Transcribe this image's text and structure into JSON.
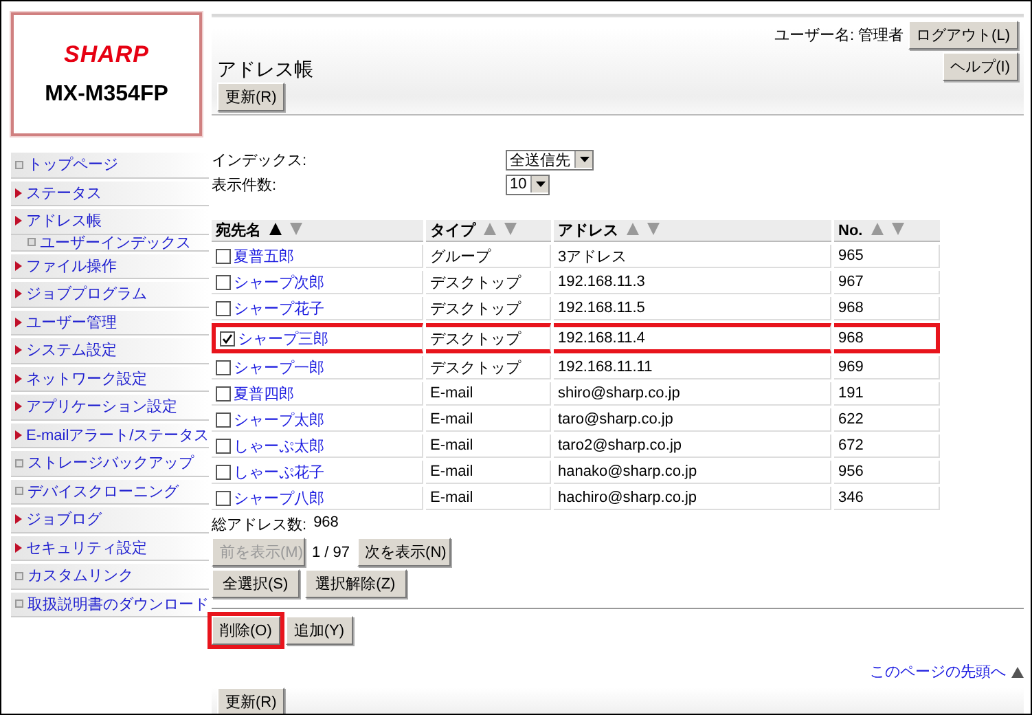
{
  "logo": {
    "brand": "SHARP",
    "model": "MX-M354FP"
  },
  "sidebar": {
    "items": [
      {
        "label": "トップページ",
        "kind": "square"
      },
      {
        "label": "ステータス",
        "kind": "arrow"
      },
      {
        "label": "アドレス帳",
        "kind": "arrow",
        "children": [
          {
            "label": "ユーザーインデックス",
            "kind": "square"
          }
        ]
      },
      {
        "label": "ファイル操作",
        "kind": "arrow"
      },
      {
        "label": "ジョブプログラム",
        "kind": "arrow"
      },
      {
        "label": "ユーザー管理",
        "kind": "arrow"
      },
      {
        "label": "システム設定",
        "kind": "arrow"
      },
      {
        "label": "ネットワーク設定",
        "kind": "arrow"
      },
      {
        "label": "アプリケーション設定",
        "kind": "arrow"
      },
      {
        "label": "E-mailアラート/ステータス",
        "kind": "arrow"
      },
      {
        "label": "ストレージバックアップ",
        "kind": "square"
      },
      {
        "label": "デバイスクローニング",
        "kind": "square"
      },
      {
        "label": "ジョブログ",
        "kind": "arrow"
      },
      {
        "label": "セキュリティ設定",
        "kind": "arrow"
      },
      {
        "label": "カスタムリンク",
        "kind": "square"
      },
      {
        "label": "取扱説明書のダウンロード",
        "kind": "square"
      }
    ]
  },
  "header": {
    "user_label": "ユーザー名:",
    "user_name": "管理者",
    "logout_button": "ログアウト(L)",
    "help_button": "ヘルプ(I)",
    "title": "アドレス帳",
    "refresh_button": "更新(R)"
  },
  "filters": [
    {
      "label": "インデックス:",
      "value": "全送信先"
    },
    {
      "label": "表示件数:",
      "value": "10"
    }
  ],
  "table": {
    "columns": [
      {
        "label": "宛先名",
        "sorted": true
      },
      {
        "label": "タイプ",
        "sorted": false
      },
      {
        "label": "アドレス",
        "sorted": false
      },
      {
        "label": "No.",
        "sorted": false
      }
    ],
    "rows": [
      {
        "checked": false,
        "highlighted": false,
        "name": "夏普五郎",
        "type": "グループ",
        "address": "3アドレス",
        "no": "965"
      },
      {
        "checked": false,
        "highlighted": false,
        "name": "シャープ次郎",
        "type": "デスクトップ",
        "address": "192.168.11.3",
        "no": "967"
      },
      {
        "checked": false,
        "highlighted": false,
        "name": "シャープ花子",
        "type": "デスクトップ",
        "address": "192.168.11.5",
        "no": "968"
      },
      {
        "checked": true,
        "highlighted": true,
        "name": "シャープ三郎",
        "type": "デスクトップ",
        "address": "192.168.11.4",
        "no": "968"
      },
      {
        "checked": false,
        "highlighted": false,
        "name": "シャープ一郎",
        "type": "デスクトップ",
        "address": "192.168.11.11",
        "no": "969"
      },
      {
        "checked": false,
        "highlighted": false,
        "name": "夏普四郎",
        "type": "E-mail",
        "address": "shiro@sharp.co.jp",
        "no": "191"
      },
      {
        "checked": false,
        "highlighted": false,
        "name": "シャープ太郎",
        "type": "E-mail",
        "address": "taro@sharp.co.jp",
        "no": "622"
      },
      {
        "checked": false,
        "highlighted": false,
        "name": "しゃーぷ太郎",
        "type": "E-mail",
        "address": "taro2@sharp.co.jp",
        "no": "672"
      },
      {
        "checked": false,
        "highlighted": false,
        "name": "しゃーぷ花子",
        "type": "E-mail",
        "address": "hanako@sharp.co.jp",
        "no": "956"
      },
      {
        "checked": false,
        "highlighted": false,
        "name": "シャープ八郎",
        "type": "E-mail",
        "address": "hachiro@sharp.co.jp",
        "no": "346"
      }
    ]
  },
  "total": {
    "label": "総アドレス数:",
    "value": "968"
  },
  "pager": {
    "prev": {
      "label": "前を表示(M)",
      "disabled": true
    },
    "page": "1 / 97",
    "next": {
      "label": "次を表示(N)",
      "disabled": false
    }
  },
  "selection_buttons": [
    "全選択(S)",
    "選択解除(Z)"
  ],
  "actions": [
    {
      "label": "削除(O)",
      "highlighted": true
    },
    {
      "label": "追加(Y)",
      "highlighted": false
    }
  ],
  "top_link": "このページの先頭へ",
  "footer": {
    "refresh_button": "更新(R)"
  }
}
